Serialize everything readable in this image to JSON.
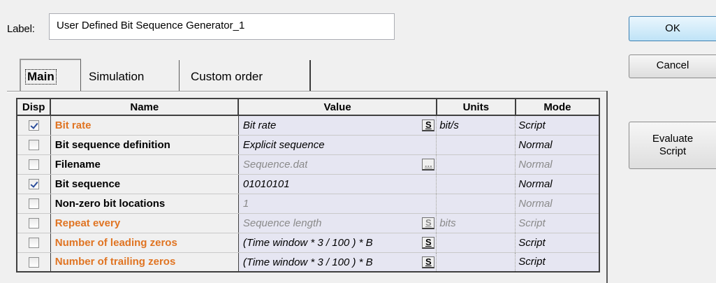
{
  "label": {
    "caption": "Label:",
    "value": "User Defined Bit Sequence Generator_1"
  },
  "buttons": {
    "ok": "OK",
    "cancel": "Cancel",
    "evaluate": "Evaluate\nScript"
  },
  "tabs": [
    "Main",
    "Simulation",
    "Custom order"
  ],
  "table": {
    "headers": {
      "disp": "Disp",
      "name": "Name",
      "value": "Value",
      "units": "Units",
      "mode": "Mode"
    },
    "rows": [
      {
        "checked": true,
        "name": "Bit rate",
        "name_style": "script",
        "value": "Bit rate",
        "value_btn": "S",
        "units": "bit/s",
        "mode": "Script",
        "dim": false
      },
      {
        "checked": false,
        "name": "Bit sequence definition",
        "name_style": "normal",
        "value": "Explicit sequence",
        "value_btn": "",
        "units": "",
        "mode": "Normal",
        "dim": false
      },
      {
        "checked": false,
        "name": "Filename",
        "name_style": "normal",
        "value": "Sequence.dat",
        "value_btn": "...",
        "units": "",
        "mode": "Normal",
        "dim": true
      },
      {
        "checked": true,
        "name": "Bit sequence",
        "name_style": "normal",
        "value": "01010101",
        "value_btn": "",
        "units": "",
        "mode": "Normal",
        "dim": false
      },
      {
        "checked": false,
        "name": "Non-zero bit locations",
        "name_style": "normal",
        "value": "1",
        "value_btn": "",
        "units": "",
        "mode": "Normal",
        "dim": true
      },
      {
        "checked": false,
        "name": "Repeat every",
        "name_style": "script",
        "value": "Sequence length",
        "value_btn": "S",
        "units": "bits",
        "mode": "Script",
        "dim": true
      },
      {
        "checked": false,
        "name": "Number of leading zeros",
        "name_style": "script",
        "value": "(Time window * 3 / 100 ) * B",
        "value_btn": "S",
        "units": "",
        "mode": "Script",
        "dim": false
      },
      {
        "checked": false,
        "name": "Number of trailing zeros",
        "name_style": "script",
        "value": "(Time window * 3 / 100 ) * B",
        "value_btn": "S",
        "units": "",
        "mode": "Script",
        "dim": false
      }
    ]
  },
  "colors": {
    "script_name": "#e07422",
    "value_bg": "#e6e6f2",
    "ok_border": "#3c7fb1"
  }
}
